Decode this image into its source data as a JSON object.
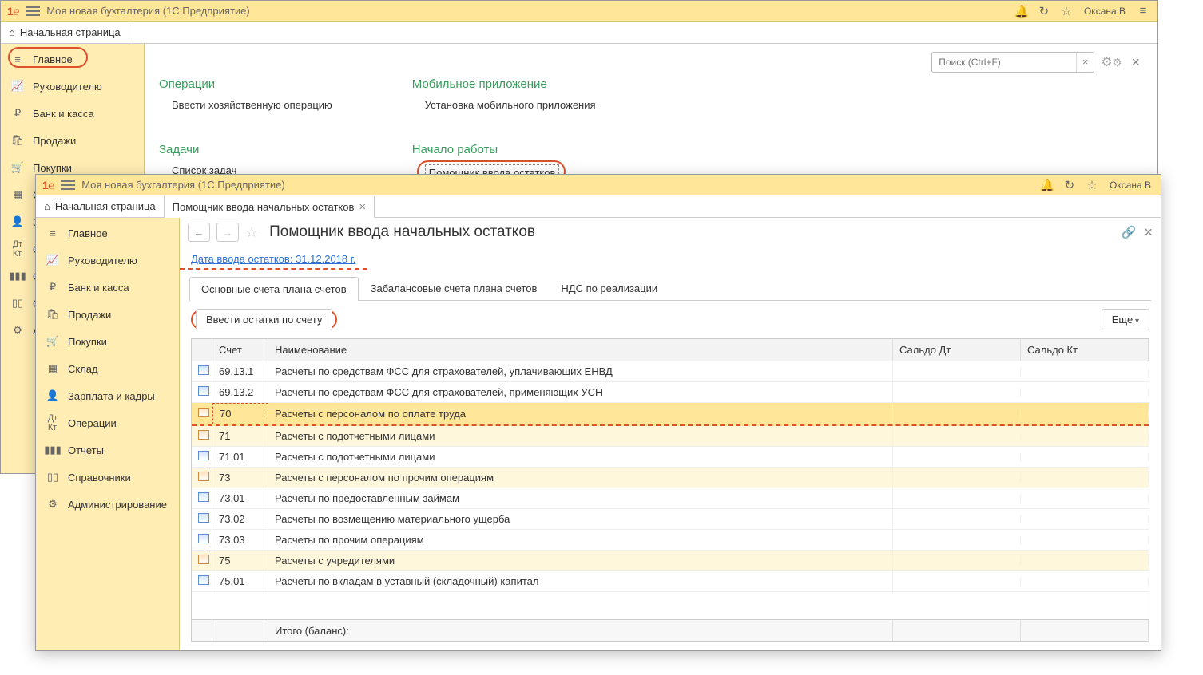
{
  "app": {
    "title": "Моя новая бухгалтерия  (1С:Предприятие)",
    "user": "Оксана В"
  },
  "home_tab": "Начальная страница",
  "sidebar_items": [
    {
      "id": "glavnoe",
      "label": "Главное"
    },
    {
      "id": "rukovoditelyu",
      "label": "Руководителю"
    },
    {
      "id": "bank",
      "label": "Банк и касса"
    },
    {
      "id": "prodazhi",
      "label": "Продажи"
    },
    {
      "id": "pokupki",
      "label": "Покупки"
    },
    {
      "id": "sklad",
      "label": "Склад"
    },
    {
      "id": "zarplata",
      "label": "Зарплата и кадры"
    },
    {
      "id": "operacii",
      "label": "Операции"
    },
    {
      "id": "otchety",
      "label": "Отчеты"
    },
    {
      "id": "spravochniki",
      "label": "Справочники"
    },
    {
      "id": "admin",
      "label": "Администрирование"
    }
  ],
  "search_placeholder": "Поиск (Ctrl+F)",
  "sections": {
    "operacii_title": "Операции",
    "operacii_item": "Ввести хозяйственную операцию",
    "mobile_title": "Мобильное приложение",
    "mobile_item": "Установка мобильного приложения",
    "zadachi_title": "Задачи",
    "zadachi_item": "Список задач",
    "nachalo_title": "Начало работы",
    "nachalo_item": "Помощник ввода остатков"
  },
  "assistant": {
    "tab_label": "Помощник ввода начальных остатков",
    "title": "Помощник ввода начальных остатков",
    "date_link": "Дата ввода остатков: 31.12.2018 г.",
    "inner_tabs": [
      "Основные счета плана счетов",
      "Забалансовые счета плана счетов",
      "НДС по реализации"
    ],
    "action_btn": "Ввести остатки по счету",
    "more_btn": "Еще",
    "columns": {
      "schet": "Счет",
      "name": "Наименование",
      "dt": "Сальдо Дт",
      "kt": "Сальдо Кт"
    },
    "rows": [
      {
        "code": "69.13.1",
        "name": "Расчеты по средствам ФСС для страхователей, уплачивающих ЕНВД",
        "alt": 0
      },
      {
        "code": "69.13.2",
        "name": "Расчеты по средствам ФСС для страхователей, применяющих УСН",
        "alt": 0
      },
      {
        "code": "70",
        "name": "Расчеты с персоналом по оплате труда",
        "alt": 1,
        "selected": true
      },
      {
        "code": "71",
        "name": "Расчеты с подотчетными лицами",
        "alt": 1
      },
      {
        "code": "71.01",
        "name": "Расчеты с подотчетными лицами",
        "alt": 0
      },
      {
        "code": "73",
        "name": "Расчеты с персоналом по прочим операциям",
        "alt": 1
      },
      {
        "code": "73.01",
        "name": "Расчеты по предоставленным займам",
        "alt": 0
      },
      {
        "code": "73.02",
        "name": "Расчеты по возмещению материального ущерба",
        "alt": 0
      },
      {
        "code": "73.03",
        "name": "Расчеты по прочим операциям",
        "alt": 0
      },
      {
        "code": "75",
        "name": "Расчеты с учредителями",
        "alt": 1
      },
      {
        "code": "75.01",
        "name": "Расчеты по вкладам в уставный (складочный) капитал",
        "alt": 0
      }
    ],
    "footer_label": "Итого (баланс):"
  }
}
